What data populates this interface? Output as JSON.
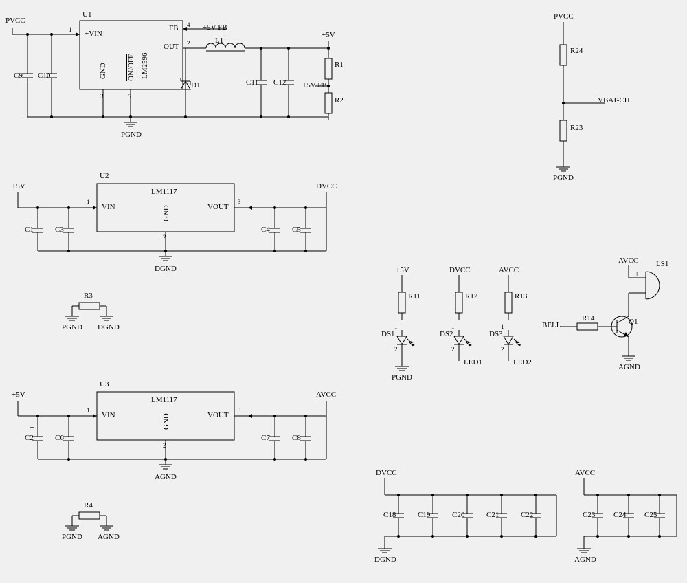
{
  "nets": {
    "pvcc": "PVCC",
    "pgnd": "PGND",
    "dgnd": "DGND",
    "agnd": "AGND",
    "p5v": "+5V",
    "p5v_fb": "+5V FB",
    "dvcc": "DVCC",
    "avcc": "AVCC",
    "vbat_ch": "VBAT-CH",
    "bell": "BELL",
    "led1": "LED1",
    "led2": "LED2"
  },
  "parts": {
    "u1": {
      "ref": "U1",
      "type": "LM2596",
      "pins": {
        "vin": "+VIN",
        "gnd": "GND",
        "onoff": "ON/OFF",
        "fb": "FB",
        "out": "OUT",
        "p1": "1",
        "p2": "2",
        "p3": "3",
        "p4": "4",
        "p5": "5"
      }
    },
    "u2": {
      "ref": "U2",
      "type": "LM1117",
      "pins": {
        "vin": "VIN",
        "gnd": "GND",
        "vout": "VOUT",
        "p1": "1",
        "p2": "2",
        "p3": "3"
      }
    },
    "u3": {
      "ref": "U3",
      "type": "LM1117",
      "pins": {
        "vin": "VIN",
        "gnd": "GND",
        "vout": "VOUT",
        "p1": "1",
        "p2": "2",
        "p3": "3"
      }
    },
    "l1": "L1",
    "d1": "D1",
    "q1": "Q1",
    "ls1": "LS1",
    "plus": "+",
    "ds1": "DS1",
    "ds2": "DS2",
    "ds3": "DS3",
    "r1": "R1",
    "r2": "R2",
    "r3": "R3",
    "r4": "R4",
    "r11": "R11",
    "r12": "R12",
    "r13": "R13",
    "r14": "R14",
    "r23": "R23",
    "r24": "R24",
    "c1": "C1",
    "c2": "C2",
    "c3": "C3",
    "c4": "C4",
    "c5": "C5",
    "c6": "C6",
    "c7": "C7",
    "c8": "C8",
    "c9": "C9",
    "c10": "C10",
    "c11": "C11",
    "c12": "C12",
    "c18": "C18",
    "c19": "C19",
    "c20": "C20",
    "c21": "C21",
    "c22": "C22",
    "c23": "C23",
    "c24": "C24",
    "c25": "C25",
    "pin1": "1",
    "pin2": "2"
  }
}
